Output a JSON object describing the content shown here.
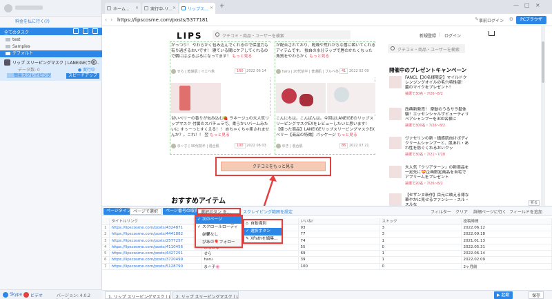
{
  "sidebar": {
    "link": "料金を払に行く(?)",
    "tabs_label": "全てのタスク",
    "tree": [
      "test",
      "Samples",
      "デフォルト"
    ],
    "task": {
      "title": "リップ スリーピングマスク | LANEIGE(ラネ...",
      "meta": "データ数: 0",
      "status": "● 実行中",
      "progress": "簡易スクレイピング",
      "speed_btn": "スピードアップ"
    },
    "footer": {
      "skype": "Skype",
      "video": "ビデオ",
      "version": "バージョン: 4.0.2 beta.2"
    }
  },
  "browser": {
    "tabs": [
      "ホーム...",
      "実行中-リ...",
      "リップス..."
    ],
    "plus": "+",
    "url": "https://lipscosme.com/posts/5377181",
    "login": "事前ログイン",
    "pc_btn": "PCブラウザ"
  },
  "lips": {
    "logo": "LIPS",
    "search_placeholder": "クチコミ・商品・ユーザーを検索",
    "signup": "新規登録",
    "divider": "|",
    "login": "ログイン",
    "side_search": "クチコミ・商品・ユーザーを検索",
    "cards": [
      {
        "text": "がっつり！ やわらかく包み込んでくれるので保湿力も有り過ぎるおいです！ 寝ている間にケアしてくれるので朝にはぷるぷるになってます！",
        "more": "もっと見る",
        "user": "せら | 乾燥肌 | イエベ秋",
        "date": "2022 06 14",
        "likes": "160"
      },
      {
        "text": "が配合されており、乾燥や荒れがちな唇に瞬いてくれるアイテムです。 独自の水分ラップで唇のかたくなった角質をやわらかく",
        "more": "もっと見る",
        "user": "haru | 20代前半 | 普通肌 | ブルベ冬",
        "date": "2022 02 09",
        "likes": "41"
      },
      {
        "text": "甘いベリーの香りが包み込む🍓 ラネージュの大人気リップマスク 付属のスパチュラで、柔らかいバームみたいに すぅーっとすくえる！！ めちゃくちゃ柔されませんか？。これ！！ 翌",
        "more": "もっと見る",
        "user": "ま〃子 | 30代前半 | 混合肌",
        "date": "2022 06 03",
        "likes": "100"
      },
      {
        "text": "こんにちは。こんばんは。今回はLANEIGEのリップスリーピングマスクEXをレビューしたいと思います！【使った商品】LANEIGEリップスリーピングマスクEXベリー【商品の特徴】パッケージ",
        "more": "もっと見る",
        "user": "ゆき | 混合肌",
        "date": "2022 07 21",
        "likes": "86"
      }
    ],
    "more_button": "クチコミをもっと見る",
    "recommend": "おすすめアイテム",
    "present_title": "開催中のプレゼントキャンペーン",
    "presents": [
      {
        "text": "FANCL【30名様限定】マイルドクレンジングオイルの毛穴特性版！ 菌のマイクをプレゼント！",
        "sub": "抽選で30名・7/26~8/2"
      },
      {
        "text": "改典新発売！ 摩動のうるサラ髪体験！エッセンシャルザビューティリペアシャンプーを300名様に",
        "sub": "抽選で300名・7/26~8/2"
      },
      {
        "text": "ヴァセリンの新・鎮感肌向けボディクリームシャンプーと、肌あれ・あれ性を防ぐくれるおいクッ",
        "sub": "抽選で30名・7/21~7/28"
      },
      {
        "text": "大人気「クリアターン」の新商品を一足先に💝企画限定商品を自宅でアプリームをプレゼント",
        "sub": "抽選で20名・7/26~8/2"
      },
      {
        "text": "【セザンヌ新作】目元に映える様な華やかに見せるファンシー・スル・スルな",
        "sub": ""
      }
    ]
  },
  "panel": {
    "toolbar": {
      "page_type": "ページタイプ",
      "page_type_value": "ページで選択",
      "page_num": "ページ番号の取得",
      "select_btn": "選択ボタン を...",
      "scroll_set": "スクレイピング範囲を設定",
      "filter": "フィルター",
      "clear": "クリア",
      "next_page": "詳細ページに行く",
      "add_field": "フィールドを追加",
      "collapse": "折る"
    },
    "columns": [
      "",
      "タイトルリンク",
      "いいね!",
      "ストック",
      "投稿時間"
    ],
    "rows": [
      [
        "1",
        "https://lipscosme.com/posts/4324871",
        "",
        "93",
        "3",
        "2022.06.12"
      ],
      [
        "2",
        "https://lipscosme.com/posts/4441882",
        "",
        "77",
        "3",
        "2022.09.18"
      ],
      [
        "3",
        "https://lipscosme.com/posts/2577257",
        "",
        "74",
        "1",
        "2021.01.13"
      ],
      [
        "4",
        "https://lipscosme.com/posts/4110456",
        "ほるほる",
        "55",
        "0",
        "2022.05.31"
      ],
      [
        "5",
        "https://lipscosme.com/posts/4427251",
        "せら",
        "69",
        "1",
        "2022.06.14"
      ],
      [
        "6",
        "https://lipscosme.com/posts/3720499",
        "haru",
        "39",
        "1",
        "2022.02.09"
      ],
      [
        "7",
        "https://lipscosme.com/posts/5128790",
        "ま〃子🌸",
        "100",
        "0",
        "2ヶ月前"
      ]
    ],
    "dropdown1": [
      "次のページ",
      "スクロールローディング",
      "必要なし"
    ],
    "dropdown1_extra": "ぴあの🎈フォロー",
    "dropdown2": [
      "自動識別",
      "選択ボタン",
      "XPathを編集..."
    ],
    "tabs": [
      "1. リップ スリーピングマスク | L...",
      "2. リップ スリーピングマスク | L..."
    ],
    "start_btn": "▶ 起動",
    "save_btn": "保存"
  },
  "colors": {
    "accent": "#2d87e6",
    "highlight_red": "#e34040",
    "lips_pink": "#e84a5f"
  }
}
